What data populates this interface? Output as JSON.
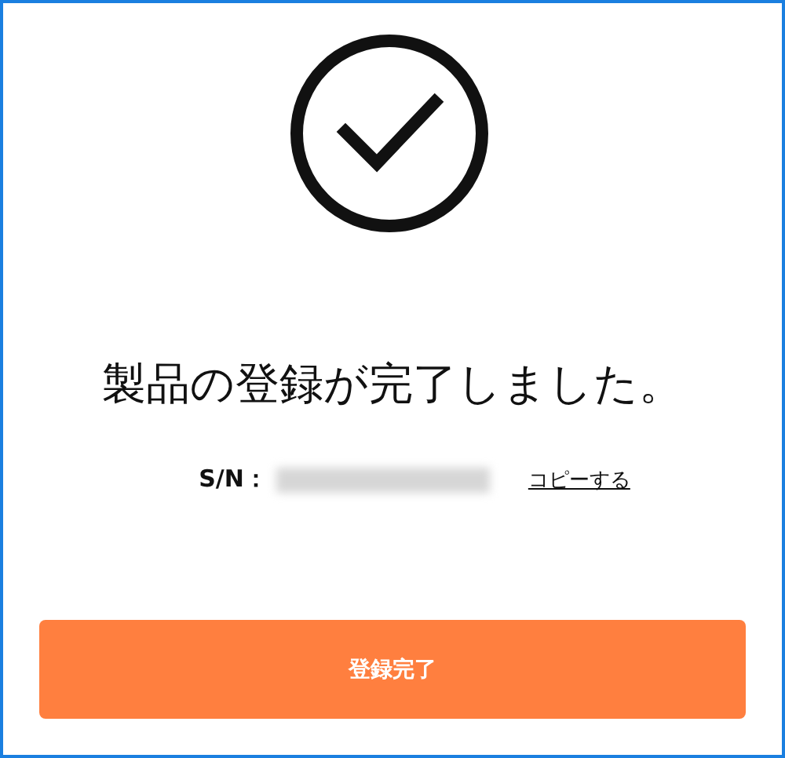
{
  "title": "製品の登録が完了しました。",
  "serial": {
    "label": "S/N：",
    "redacted": true,
    "copy_link": "コピーする"
  },
  "button": "登録完了"
}
